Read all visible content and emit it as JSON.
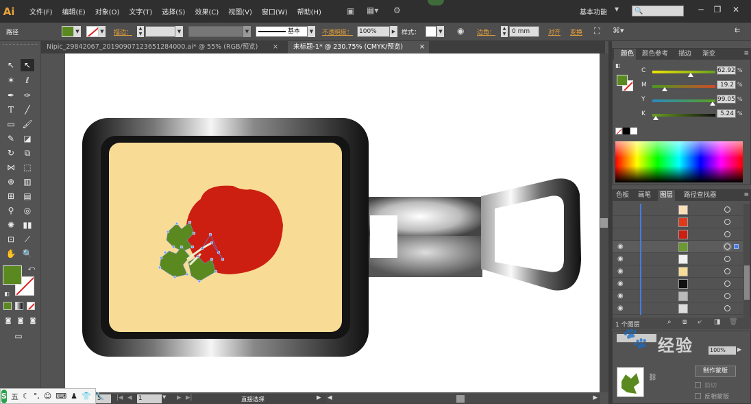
{
  "app": {
    "logo": "Ai"
  },
  "menu": [
    "文件(F)",
    "编辑(E)",
    "对象(O)",
    "文字(T)",
    "选择(S)",
    "效果(C)",
    "视图(V)",
    "窗口(W)",
    "帮助(H)"
  ],
  "workspace": {
    "label": "基本功能"
  },
  "control": {
    "selection_label": "路径",
    "stroke_label": "描边：",
    "stroke_style": "基本",
    "opacity_label": "不透明度：",
    "opacity_value": "100%",
    "style_label": "样式：",
    "corner_label": "边角：",
    "corner_value": "0 mm",
    "align_label": "对齐",
    "transform_label": "变换",
    "fill_color": "#5a8a1f"
  },
  "tabs": [
    {
      "label": "Nipic_29842067_20190907123651284000.ai* @ 55% (RGB/预览)",
      "close": "×"
    },
    {
      "label": "未标题-1* @ 230.75% (CMYK/预览)",
      "close": "×"
    }
  ],
  "color_panel": {
    "tabs": [
      "颜色",
      "颜色参考",
      "描边",
      "渐变"
    ],
    "sliders": [
      {
        "label": "C",
        "value": "62.92",
        "pct": "%",
        "pos": 0.63
      },
      {
        "label": "M",
        "value": "19.2",
        "pct": "%",
        "pos": 0.19
      },
      {
        "label": "Y",
        "value": "99.05",
        "pct": "%",
        "pos": 0.99
      },
      {
        "label": "K",
        "value": "5.24",
        "pct": "%",
        "pos": 0.05
      }
    ]
  },
  "layers_panel": {
    "tabs": [
      "色板",
      "画笔",
      "图层",
      "路径查找器"
    ],
    "footer": "1 个图层",
    "rows": [
      {
        "color": "#f9e0b8",
        "eye": "",
        "selected": false
      },
      {
        "color": "#e03a1a",
        "eye": "",
        "selected": false
      },
      {
        "color": "#cc1f12",
        "eye": "",
        "selected": false
      },
      {
        "color": "#6a9a30",
        "eye": "👁",
        "selected": true
      },
      {
        "color": "#f2f2f2",
        "eye": "👁",
        "selected": false
      },
      {
        "color": "#f7dc95",
        "eye": "👁",
        "selected": false
      },
      {
        "color": "#111111",
        "eye": "👁",
        "selected": false
      },
      {
        "color": "#bbbbbb",
        "eye": "👁",
        "selected": false
      },
      {
        "color": "#dddddd",
        "eye": "👁",
        "selected": false
      }
    ]
  },
  "mask_panel": {
    "make_mask": "制作蒙版",
    "clip": "剪切",
    "invert": "反相蒙版",
    "opacity": "100%"
  },
  "status": {
    "zoom": "5",
    "page": "1",
    "tool_mode": "直接选择"
  },
  "ime": {
    "mode": "五"
  },
  "watermark": {
    "text": "经验"
  },
  "search": {
    "placeholder": ""
  }
}
